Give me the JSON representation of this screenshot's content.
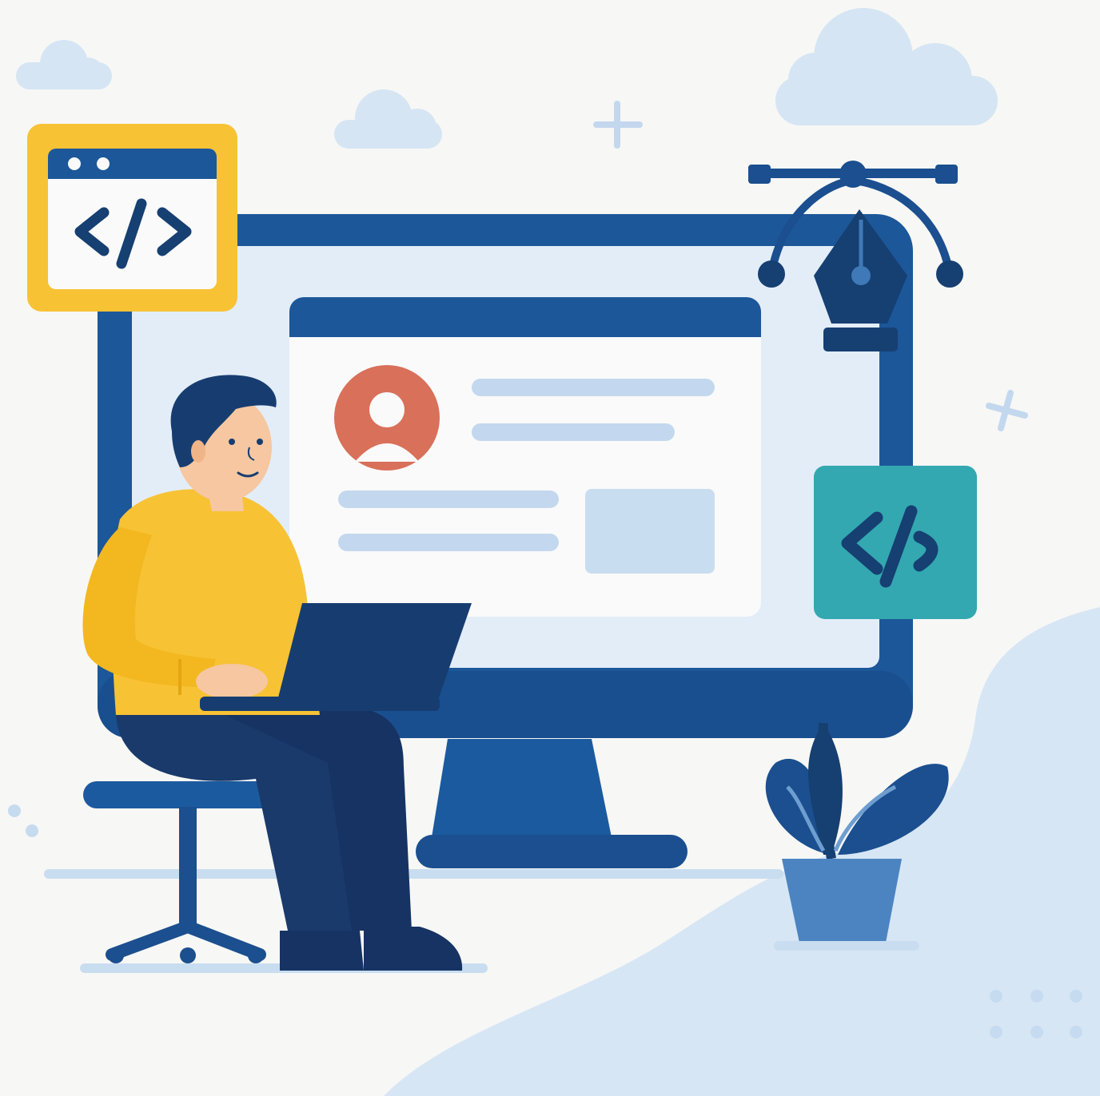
{
  "illustration": {
    "code_badge_symbol": "</>",
    "code_badge_alt_symbol": "</>",
    "icons": [
      "cloud-icon",
      "sparkle-plus-icon",
      "code-window-icon",
      "code-tag-icon",
      "pen-tool-icon",
      "user-avatar-icon",
      "plant-icon",
      "chair-icon",
      "laptop-icon",
      "monitor-icon"
    ]
  },
  "colors": {
    "background": "#f7f7f5",
    "navy": "#1b4f8f",
    "dark_navy": "#133a6b",
    "light_blue": "#c9ddf0",
    "pale_blue": "#e4eef8",
    "yellow": "#f7c234",
    "teal": "#33a8b0",
    "avatar_orange": "#d9705a",
    "skin": "#f6c7a0"
  }
}
